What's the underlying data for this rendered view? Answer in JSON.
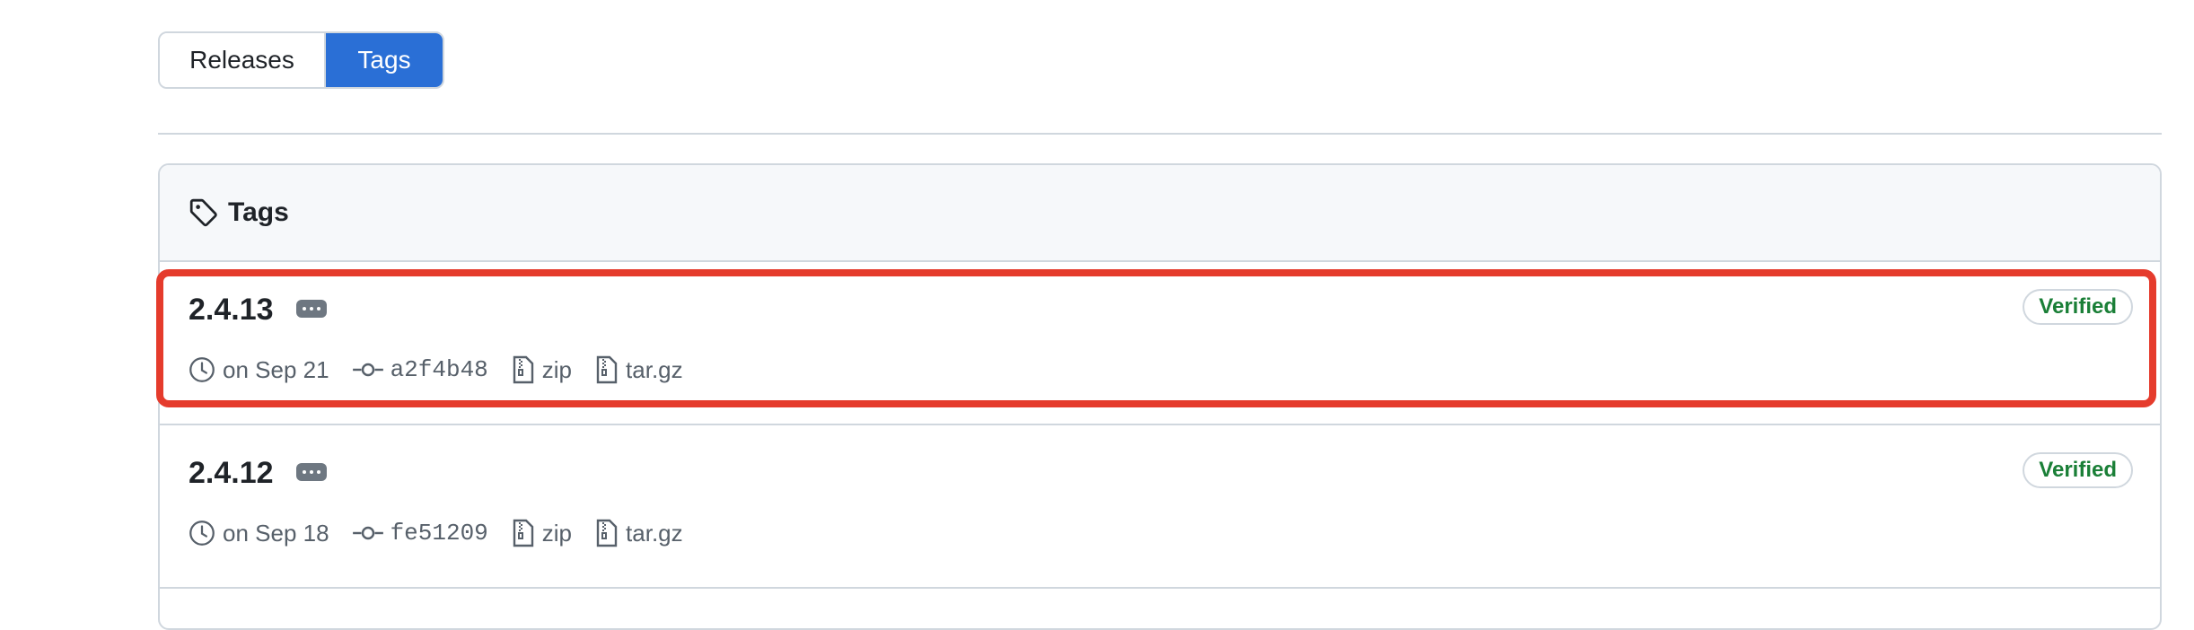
{
  "nav": {
    "releases_label": "Releases",
    "tags_label": "Tags",
    "active": "Tags"
  },
  "box": {
    "title": "Tags"
  },
  "tags": [
    {
      "name": "2.4.13",
      "date": "on Sep 21",
      "commit": "a2f4b48",
      "zip": "zip",
      "targz": "tar.gz",
      "badge": "Verified"
    },
    {
      "name": "2.4.12",
      "date": "on Sep 18",
      "commit": "fe51209",
      "zip": "zip",
      "targz": "tar.gz",
      "badge": "Verified"
    }
  ],
  "colors": {
    "accent": "#2a6fd6",
    "verified": "#1a7f37",
    "highlight": "#e53b2c"
  },
  "icons": [
    "tag-icon",
    "clock-icon",
    "commit-icon",
    "file-zip-icon",
    "kebab-horizontal-icon"
  ]
}
